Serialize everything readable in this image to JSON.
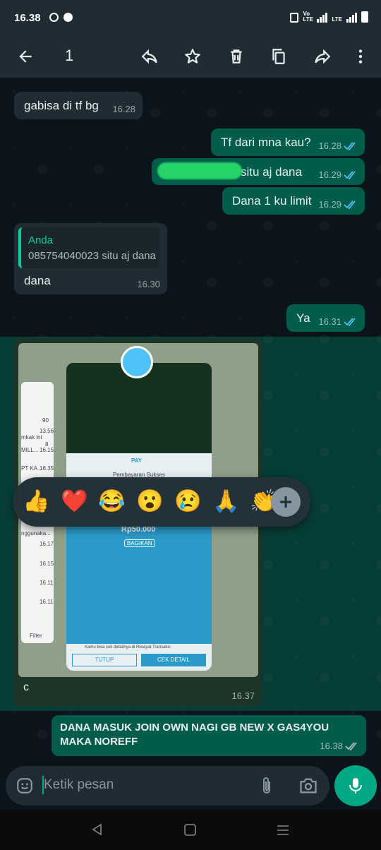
{
  "status_bar": {
    "time": "16.38",
    "net_label": "Vo LTE",
    "lte_label": "LTE"
  },
  "toolbar": {
    "selected_count": "1",
    "icons": [
      "back-arrow-icon",
      "reply-icon",
      "star-icon",
      "delete-icon",
      "copy-icon",
      "forward-icon",
      "more-vert-icon"
    ]
  },
  "messages": [
    {
      "dir": "in",
      "text": "gabisa di tf bg",
      "time": "16.28"
    },
    {
      "dir": "out",
      "text": "Tf dari mna kau?",
      "time": "16.28",
      "status": "read"
    },
    {
      "dir": "out",
      "text": "situ aj dana",
      "time": "16.29",
      "status": "read",
      "partially_redacted": true
    },
    {
      "dir": "out",
      "text": "Dana 1 ku limit",
      "time": "16.29",
      "status": "read"
    },
    {
      "dir": "in",
      "quote_author": "Anda",
      "quote_text": "085754040023 situ aj dana",
      "text": "dana",
      "time": "16.30"
    },
    {
      "dir": "out",
      "text": "Ya",
      "time": "16.31",
      "status": "read"
    },
    {
      "dir": "in",
      "type": "image",
      "caption": "c",
      "time": "16.37",
      "selected": true,
      "image_text": {
        "app": "PAY",
        "header": "Pembayaran Sukses",
        "amount": "Rp50.000",
        "share": "BAGIKAN",
        "footer_note": "Kamu bisa cek detailnya di Riwayat Transaksi",
        "close_btn": "TUTUP",
        "detail_btn": "CEK DETAIL",
        "left_panel": [
          "90",
          "13.56",
          "mkak ini",
          "8",
          "MILL...",
          "16.15",
          "PT KA...",
          "16.35",
          "nggunaka...",
          "16.17",
          "16.15",
          "16.11",
          "16.11",
          "Filter"
        ]
      }
    },
    {
      "dir": "out",
      "text": "DANA MASUK JOIN OWN NAGI GB NEW X GAS4YOU MAKA NOREFF",
      "time": "16.38",
      "status": "delivered"
    }
  ],
  "reactions": [
    "👍",
    "❤️",
    "😂",
    "😮",
    "😢",
    "🙏",
    "👏"
  ],
  "composer": {
    "placeholder": "Ketik pesan"
  },
  "colors": {
    "incoming": "#202c33",
    "outgoing": "#005c4b",
    "accent": "#00a884",
    "read_tick": "#53bdeb"
  }
}
